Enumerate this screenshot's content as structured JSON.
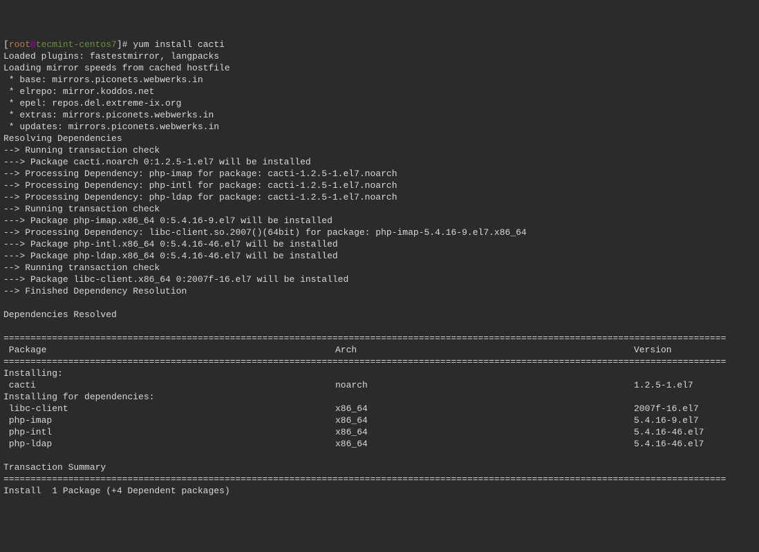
{
  "prompt": {
    "open": "[",
    "user": "root",
    "at": "@",
    "host": "tecmint-centos7",
    "close": "]",
    "hash": "#",
    "command": "yum install cacti"
  },
  "preamble": [
    "Loaded plugins: fastestmirror, langpacks",
    "Loading mirror speeds from cached hostfile",
    " * base: mirrors.piconets.webwerks.in",
    " * elrepo: mirror.koddos.net",
    " * epel: repos.del.extreme-ix.org",
    " * extras: mirrors.piconets.webwerks.in",
    " * updates: mirrors.piconets.webwerks.in",
    "Resolving Dependencies",
    "--> Running transaction check",
    "---> Package cacti.noarch 0:1.2.5-1.el7 will be installed",
    "--> Processing Dependency: php-imap for package: cacti-1.2.5-1.el7.noarch",
    "--> Processing Dependency: php-intl for package: cacti-1.2.5-1.el7.noarch",
    "--> Processing Dependency: php-ldap for package: cacti-1.2.5-1.el7.noarch",
    "--> Running transaction check",
    "---> Package php-imap.x86_64 0:5.4.16-9.el7 will be installed",
    "--> Processing Dependency: libc-client.so.2007()(64bit) for package: php-imap-5.4.16-9.el7.x86_64",
    "---> Package php-intl.x86_64 0:5.4.16-46.el7 will be installed",
    "---> Package php-ldap.x86_64 0:5.4.16-46.el7 will be installed",
    "--> Running transaction check",
    "---> Package libc-client.x86_64 0:2007f-16.el7 will be installed",
    "--> Finished Dependency Resolution",
    "",
    "Dependencies Resolved",
    ""
  ],
  "divider": "======================================================================================================================================",
  "headers": {
    "package": " Package",
    "arch": "Arch",
    "version": "Version"
  },
  "sections": {
    "installing_label": "Installing:",
    "installing": [
      {
        "package": " cacti",
        "arch": "noarch",
        "version": "1.2.5-1.el7"
      }
    ],
    "deps_label": "Installing for dependencies:",
    "deps": [
      {
        "package": " libc-client",
        "arch": "x86_64",
        "version": "2007f-16.el7"
      },
      {
        "package": " php-imap",
        "arch": "x86_64",
        "version": "5.4.16-9.el7"
      },
      {
        "package": " php-intl",
        "arch": "x86_64",
        "version": "5.4.16-46.el7"
      },
      {
        "package": " php-ldap",
        "arch": "x86_64",
        "version": "5.4.16-46.el7"
      }
    ]
  },
  "footer": [
    "",
    "Transaction Summary"
  ],
  "install_summary": "Install  1 Package (+4 Dependent packages)"
}
